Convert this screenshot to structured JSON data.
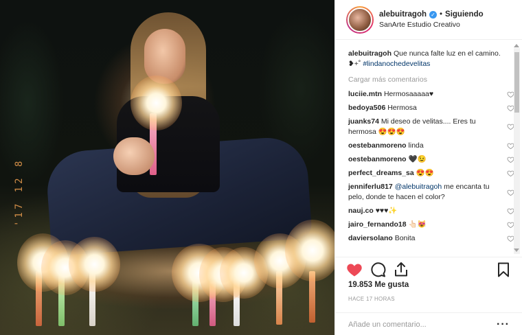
{
  "post": {
    "username": "alebuitragoh",
    "following_label": "Siguiendo",
    "location": "SanArte Estudio Creativo",
    "caption_user": "alebuitragoh",
    "caption_text": "Que nunca falte luz en el camino. ❥+˚︎ ",
    "caption_hashtag": "#lindanochedevelitas",
    "photo_stamp": "'17 12 8"
  },
  "comments": {
    "load_more": "Cargar más comentarios",
    "items": [
      {
        "user": "luciie.mtn",
        "text": "Hermosaaaaa♥"
      },
      {
        "user": "bedoya506",
        "text": "Hermosa"
      },
      {
        "user": "juanks74",
        "text": "Mi deseo de velitas.... Eres tu hermosa 😍😍😍"
      },
      {
        "user": "oestebanmoreno",
        "text": "linda"
      },
      {
        "user": "oestebanmoreno",
        "text": "🖤😉"
      },
      {
        "user": "perfect_dreams_sa",
        "text": "😍😍"
      },
      {
        "user": "jenniferlu817",
        "mention": "@alebuitragoh",
        "text": " me encanta tu pelo, donde te hacen el color?"
      },
      {
        "user": "nauj.co",
        "text": "♥♥♥✨"
      },
      {
        "user": "jairo_fernando18",
        "text": "👆🏻😻"
      },
      {
        "user": "daviersolano",
        "text": "Bonita"
      }
    ]
  },
  "actions": {
    "likes": "19.853 Me gusta",
    "time_ago": "HACE 17 HORAS",
    "add_comment_placeholder": "Añade un comentario...",
    "more_label": "···"
  },
  "colors": {
    "liked_heart": "#ed4956",
    "link": "#003569",
    "verified": "#3897f0"
  }
}
